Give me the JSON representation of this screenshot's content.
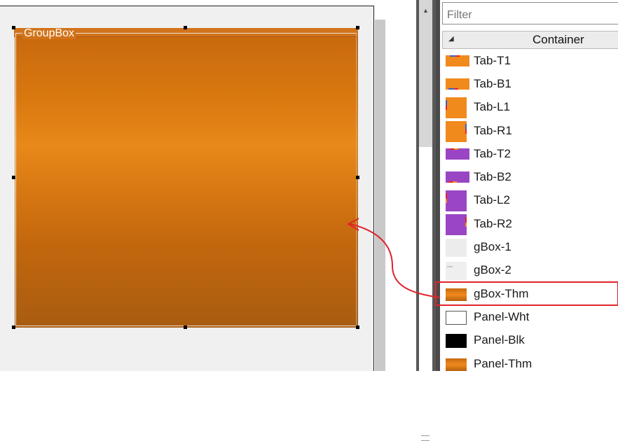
{
  "designer": {
    "groupbox": {
      "caption": "GroupBox",
      "gradient_colors": [
        "#c8690f",
        "#e8891a",
        "#a95c10"
      ]
    }
  },
  "toolbox": {
    "filter": {
      "placeholder": "Filter",
      "value": ""
    },
    "category": {
      "label": "Container",
      "expanded": true
    },
    "items": [
      {
        "label": "Tab-T1",
        "swatch": "orange"
      },
      {
        "label": "Tab-B1",
        "swatch": "orange"
      },
      {
        "label": "Tab-L1",
        "swatch": "orange"
      },
      {
        "label": "Tab-R1",
        "swatch": "orange"
      },
      {
        "label": "Tab-T2",
        "swatch": "purple"
      },
      {
        "label": "Tab-B2",
        "swatch": "purple"
      },
      {
        "label": "Tab-L2",
        "swatch": "purple"
      },
      {
        "label": "Tab-R2",
        "swatch": "purple"
      },
      {
        "label": "gBox-1",
        "swatch": "light"
      },
      {
        "label": "gBox-2",
        "swatch": "light"
      },
      {
        "label": "gBox-Thm",
        "swatch": "theme",
        "highlighted": true
      },
      {
        "label": "Panel-Wht",
        "swatch": "white"
      },
      {
        "label": "Panel-Blk",
        "swatch": "black"
      },
      {
        "label": "Panel-Thm",
        "swatch": "theme"
      }
    ]
  },
  "annotation": {
    "color": "#e0242c"
  },
  "colors": {
    "accent_orange": "#f08a1d",
    "accent_purple": "#9a46c4",
    "highlight_red": "#e0242c"
  }
}
